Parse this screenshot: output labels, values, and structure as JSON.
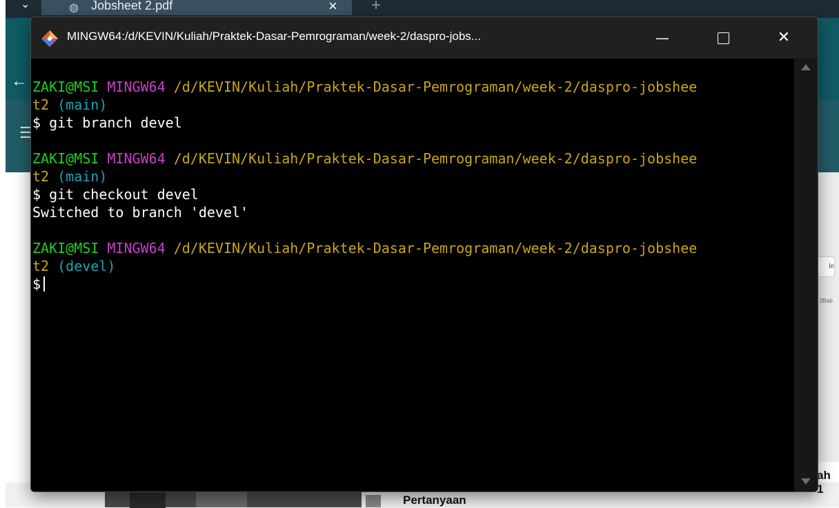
{
  "background": {
    "tab_title": "Jobsheet 2.pdf",
    "tab_close": "×",
    "new_tab": "+",
    "dropdown": "⌄",
    "back_icon": "←",
    "menu_icon": "☰",
    "side_button_text": "le",
    "side_text": "2Bab",
    "bottom_heading": "Pertanyaan",
    "bottom_right_text": "ah 1"
  },
  "terminal": {
    "title": "MINGW64:/d/KEVIN/Kuliah/Praktek-Dasar-Pemrograman/week-2/daspro-jobs...",
    "buttons": {
      "minimize": "—",
      "close": "✕"
    },
    "prompts": [
      {
        "user": "ZAKI@MSI",
        "shell": "MINGW64",
        "path_line1": "/d/KEVIN/Kuliah/Praktek-Dasar-Pemrograman/week-2/daspro-jobshee",
        "path_line2": "t2",
        "branch": "(main)",
        "command": "$ git branch devel",
        "output": ""
      },
      {
        "user": "ZAKI@MSI",
        "shell": "MINGW64",
        "path_line1": "/d/KEVIN/Kuliah/Praktek-Dasar-Pemrograman/week-2/daspro-jobshee",
        "path_line2": "t2",
        "branch": "(main)",
        "command": "$ git checkout devel",
        "output": "Switched to branch 'devel'"
      },
      {
        "user": "ZAKI@MSI",
        "shell": "MINGW64",
        "path_line1": "/d/KEVIN/Kuliah/Praktek-Dasar-Pemrograman/week-2/daspro-jobshee",
        "path_line2": "t2",
        "branch": "(devel)",
        "command": "$",
        "output": ""
      }
    ],
    "colors": {
      "user": "#1fd01f",
      "shell": "#c741c7",
      "path": "#c9a813",
      "branch": "#17a5b8",
      "background": "#000000"
    }
  }
}
